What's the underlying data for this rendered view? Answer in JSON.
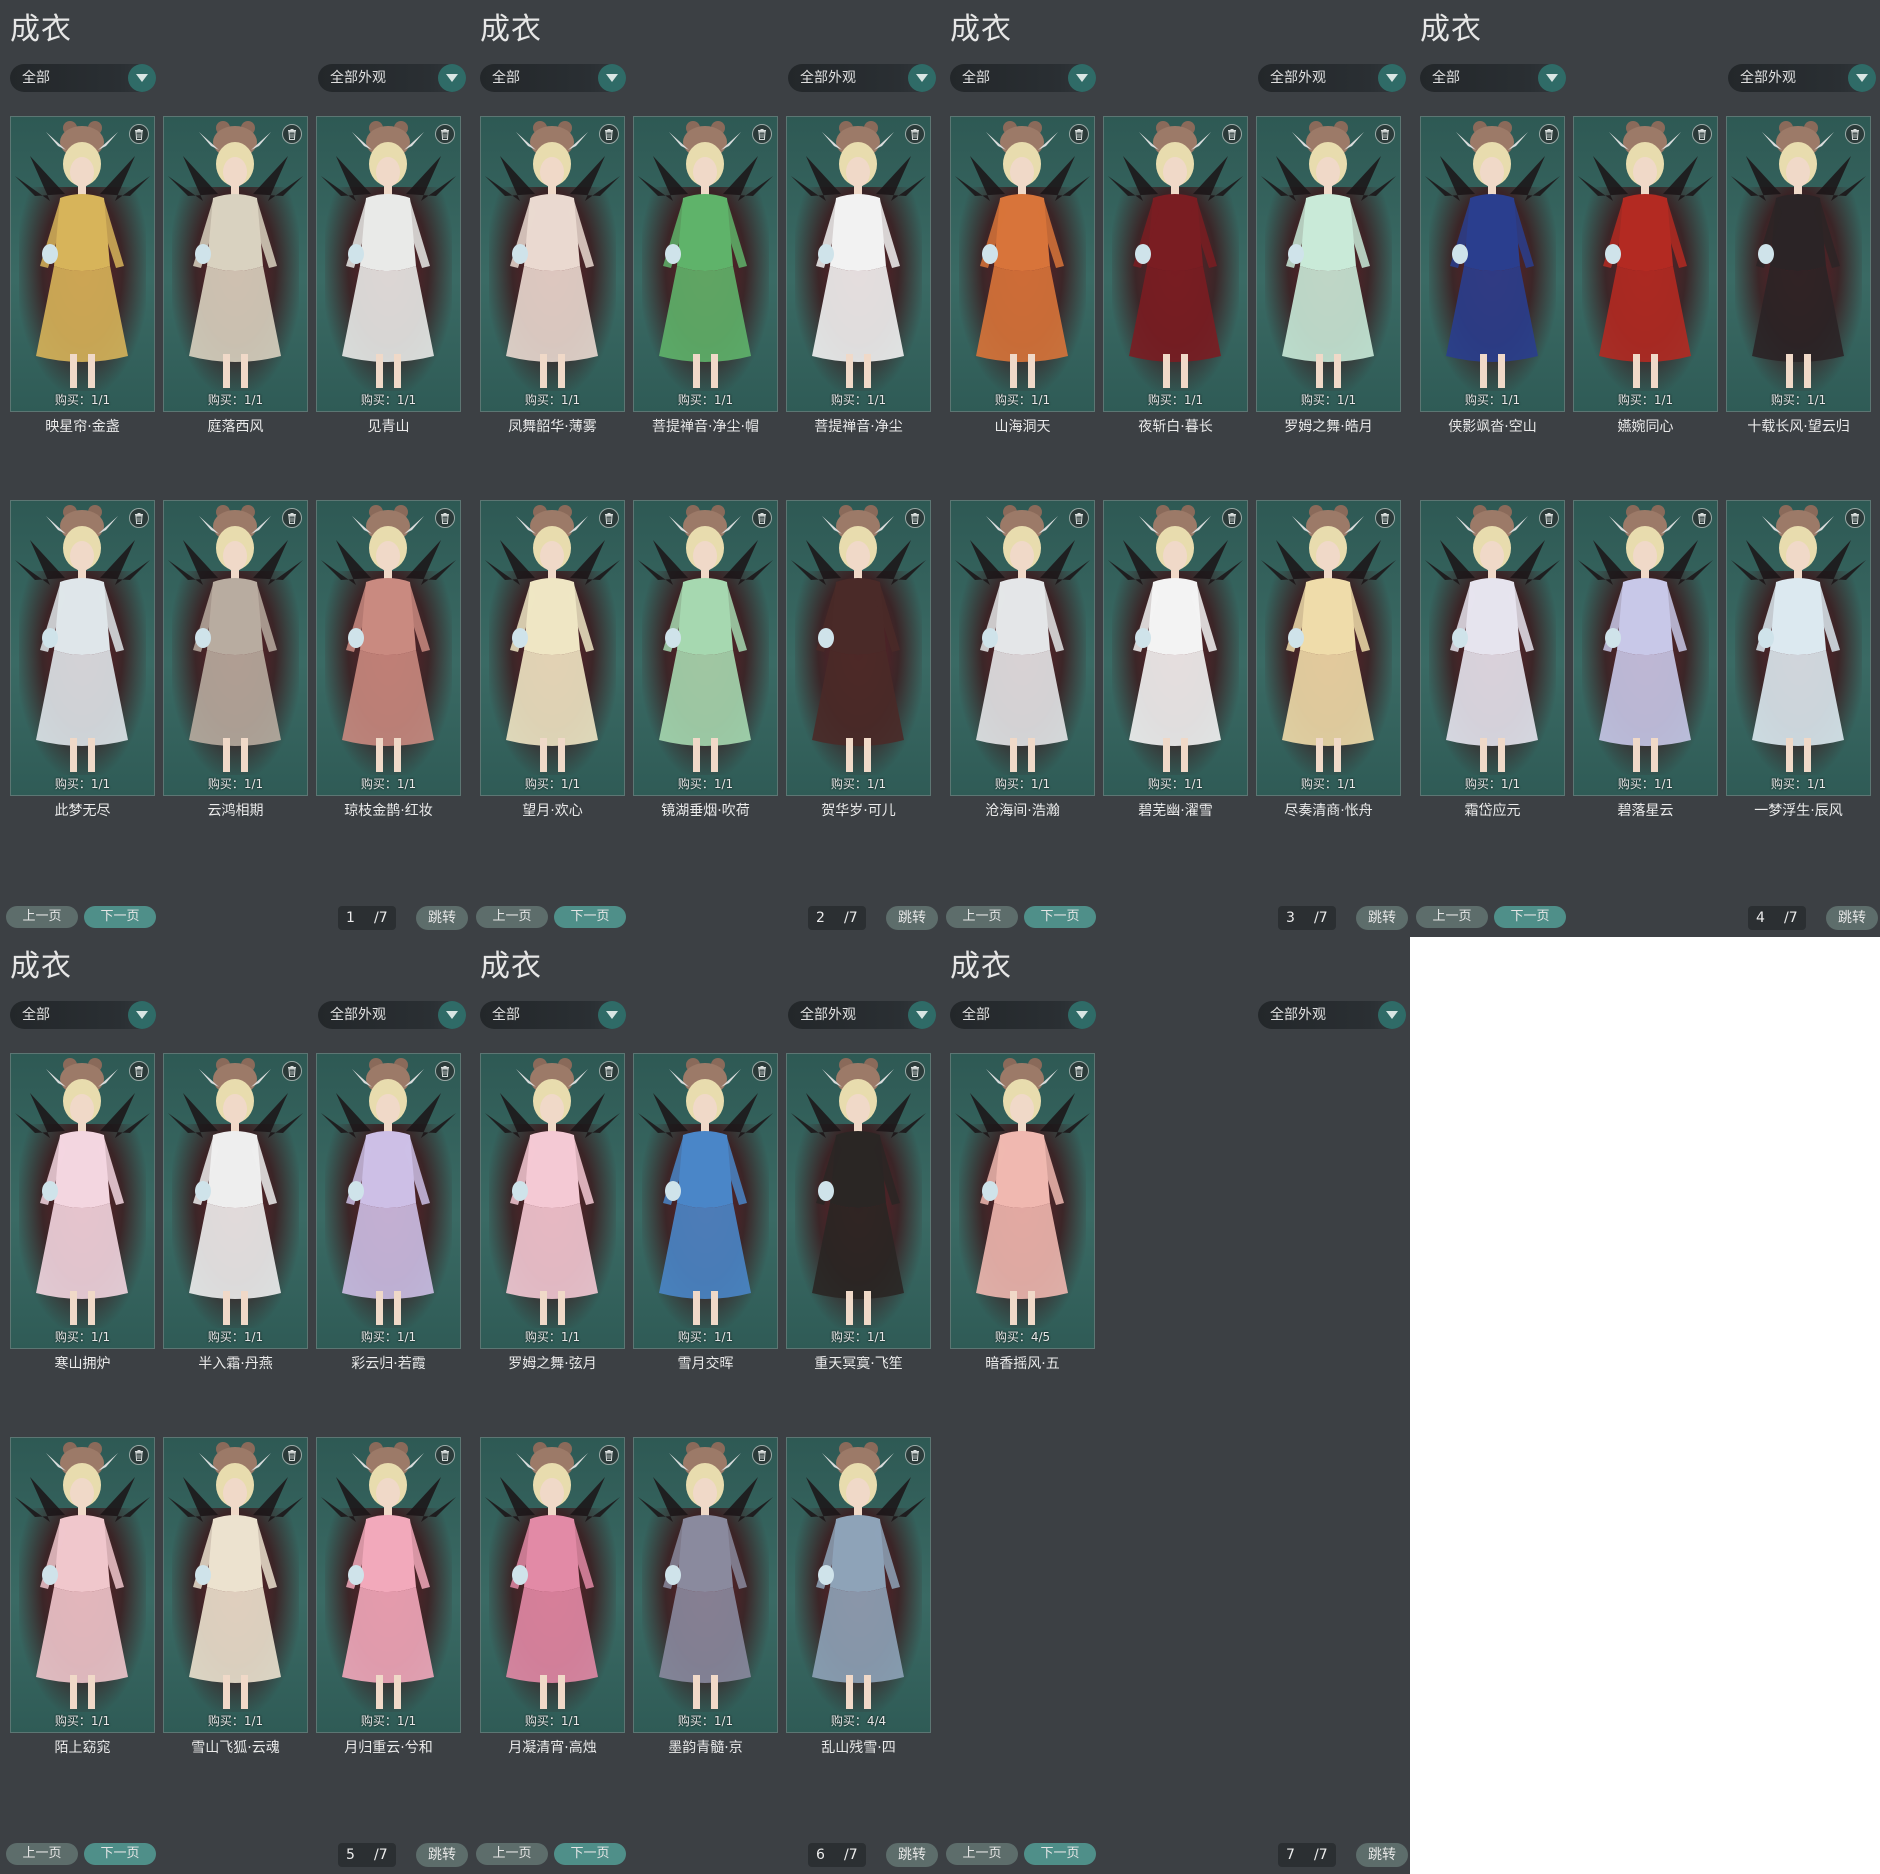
{
  "panels": [
    {
      "title": "成衣",
      "filter_left": "全部",
      "filter_right": "全部外观",
      "items": [
        {
          "name": "映星帘·金盏",
          "buy": "购买：1/1",
          "color": "#d7b45a"
        },
        {
          "name": "庭落西风",
          "buy": "购买：1/1",
          "color": "#d9d2c0"
        },
        {
          "name": "见青山",
          "buy": "购买：1/1",
          "color": "#e9eae8"
        },
        {
          "name": "此梦无尽",
          "buy": "购买：1/1",
          "color": "#dfe6ea"
        },
        {
          "name": "云鸿相期",
          "buy": "购买：1/1",
          "color": "#b8aca0"
        },
        {
          "name": "琼枝金鹊·红妆",
          "buy": "购买：1/1",
          "color": "#c98a80"
        }
      ],
      "prev": "上一页",
      "next": "下一页",
      "page": "1",
      "total": "/7",
      "jump": "跳转"
    },
    {
      "title": "成衣",
      "filter_left": "全部",
      "filter_right": "全部外观",
      "items": [
        {
          "name": "凤舞韶华·薄雾",
          "buy": "购买：1/1",
          "color": "#ead9d0"
        },
        {
          "name": "菩提禅音·净尘·帽",
          "buy": "购买：1/1",
          "color": "#5fb36a"
        },
        {
          "name": "菩提禅音·净尘",
          "buy": "购买：1/1",
          "color": "#f2f2f2"
        },
        {
          "name": "望月·欢心",
          "buy": "购买：1/1",
          "color": "#efe6c4"
        },
        {
          "name": "镜湖垂烟·吹荷",
          "buy": "购买：1/1",
          "color": "#a6d8b0"
        },
        {
          "name": "贺华岁·可儿",
          "buy": "购买：1/1",
          "color": "#4a2a28"
        }
      ],
      "prev": "上一页",
      "next": "下一页",
      "page": "2",
      "total": "/7",
      "jump": "跳转"
    },
    {
      "title": "成衣",
      "filter_left": "全部",
      "filter_right": "全部外观",
      "items": [
        {
          "name": "山海洞天",
          "buy": "购买：1/1",
          "color": "#d8743a"
        },
        {
          "name": "夜斩白·暮长",
          "buy": "购买：1/1",
          "color": "#7a1d22"
        },
        {
          "name": "罗姆之舞·皓月",
          "buy": "购买：1/1",
          "color": "#c9ead8"
        },
        {
          "name": "沧海间·浩瀚",
          "buy": "购买：1/1",
          "color": "#e4e6e8"
        },
        {
          "name": "碧芜幽·濯雪",
          "buy": "购买：1/1",
          "color": "#f3f3f3"
        },
        {
          "name": "尽奏清商·怅舟",
          "buy": "购买：1/1",
          "color": "#efdcaa"
        }
      ],
      "prev": "上一页",
      "next": "下一页",
      "page": "3",
      "total": "/7",
      "jump": "跳转"
    },
    {
      "title": "成衣",
      "filter_left": "全部",
      "filter_right": "全部外观",
      "items": [
        {
          "name": "侠影飒沓·空山",
          "buy": "购买：1/1",
          "color": "#2a3e8e"
        },
        {
          "name": "嬿婉同心",
          "buy": "购买：1/1",
          "color": "#b32a22"
        },
        {
          "name": "十载长风·望云归",
          "buy": "购买：1/1",
          "color": "#2b2426"
        },
        {
          "name": "霜岱应元",
          "buy": "购买：1/1",
          "color": "#e6e4ee"
        },
        {
          "name": "碧落星云",
          "buy": "购买：1/1",
          "color": "#c8c8e8"
        },
        {
          "name": "一梦浮生·辰风",
          "buy": "购买：1/1",
          "color": "#dce9f0"
        }
      ],
      "prev": "上一页",
      "next": "下一页",
      "page": "4",
      "total": "/7",
      "jump": "跳转"
    },
    {
      "title": "成衣",
      "filter_left": "全部",
      "filter_right": "全部外观",
      "items": [
        {
          "name": "寒山拥炉",
          "buy": "购买：1/1",
          "color": "#f3d6e0"
        },
        {
          "name": "半入霜·丹燕",
          "buy": "购买：1/1",
          "color": "#eeeeee"
        },
        {
          "name": "彩云归·若霞",
          "buy": "购买：1/1",
          "color": "#cdbfe6"
        },
        {
          "name": "陌上窈窕",
          "buy": "购买：1/1",
          "color": "#f0c7cc"
        },
        {
          "name": "雪山飞狐·云魂",
          "buy": "购买：1/1",
          "color": "#ece2cf"
        },
        {
          "name": "月归重云·兮和",
          "buy": "购买：1/1",
          "color": "#f2a9bb"
        }
      ],
      "prev": "上一页",
      "next": "下一页",
      "page": "5",
      "total": "/7",
      "jump": "跳转"
    },
    {
      "title": "成衣",
      "filter_left": "全部",
      "filter_right": "全部外观",
      "items": [
        {
          "name": "罗姆之舞·弦月",
          "buy": "购买：1/1",
          "color": "#f4c9d4"
        },
        {
          "name": "雪月交晖",
          "buy": "购买：1/1",
          "color": "#4a86c8"
        },
        {
          "name": "重天冥寞·飞笙",
          "buy": "购买：1/1",
          "color": "#2a2624"
        },
        {
          "name": "月凝清宵·高烛",
          "buy": "购买：1/1",
          "color": "#e28aa6"
        },
        {
          "name": "墨韵青髓·京",
          "buy": "购买：1/1",
          "color": "#8a8a9e"
        },
        {
          "name": "乱山残雪·四",
          "buy": "购买：4/4",
          "color": "#8ea3b8"
        }
      ],
      "prev": "上一页",
      "next": "下一页",
      "page": "6",
      "total": "/7",
      "jump": "跳转"
    },
    {
      "title": "成衣",
      "filter_left": "全部",
      "filter_right": "全部外观",
      "items": [
        {
          "name": "暗香摇风·五",
          "buy": "购买：4/5",
          "color": "#f0b8b0"
        }
      ],
      "prev": "上一页",
      "next": "下一页",
      "page": "7",
      "total": "/7",
      "jump": "跳转"
    }
  ]
}
